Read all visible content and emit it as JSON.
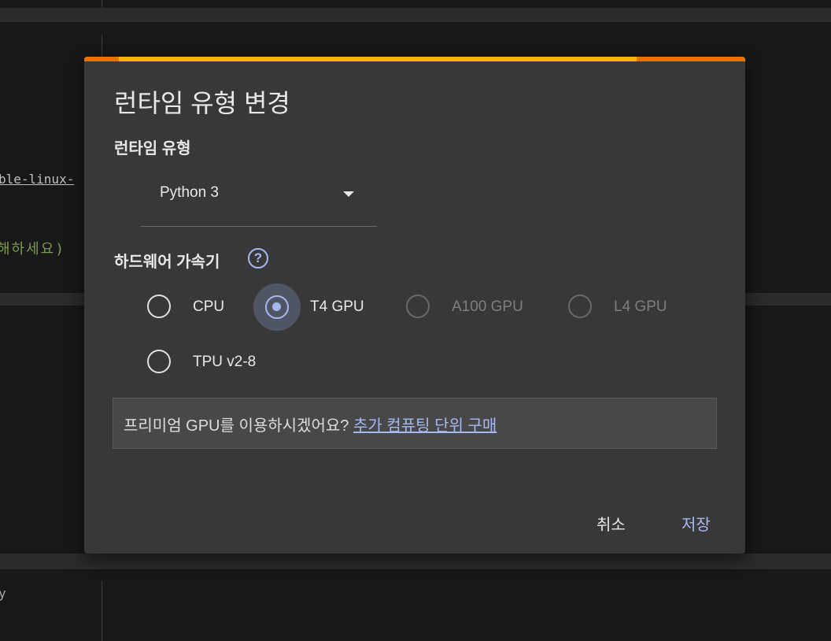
{
  "background": {
    "link_fragment": "ble-linux-",
    "comment_fragment": "해하세요)",
    "trailing_char": "y"
  },
  "dialog": {
    "title": "런타임 유형 변경",
    "runtime_type": {
      "label": "런타임 유형",
      "selected_value": "Python 3"
    },
    "accelerator": {
      "label": "하드웨어 가속기",
      "help_glyph": "?",
      "selected": "T4 GPU",
      "options": [
        {
          "label": "CPU",
          "selected": false,
          "enabled": true
        },
        {
          "label": "T4 GPU",
          "selected": true,
          "enabled": true
        },
        {
          "label": "A100 GPU",
          "selected": false,
          "enabled": false
        },
        {
          "label": "L4 GPU",
          "selected": false,
          "enabled": false
        },
        {
          "label": "TPU v2-8",
          "selected": false,
          "enabled": true
        }
      ]
    },
    "promo": {
      "text": "프리미엄 GPU를 이용하시겠어요?",
      "link": "추가 컴퓨팅 단위 구매"
    },
    "buttons": {
      "cancel": "취소",
      "save": "저장"
    }
  },
  "colors": {
    "accent": "#a6b8f0",
    "bar_yellow": "#f4b400",
    "bar_orange": "#e37400",
    "dialog_bg": "#383838"
  }
}
